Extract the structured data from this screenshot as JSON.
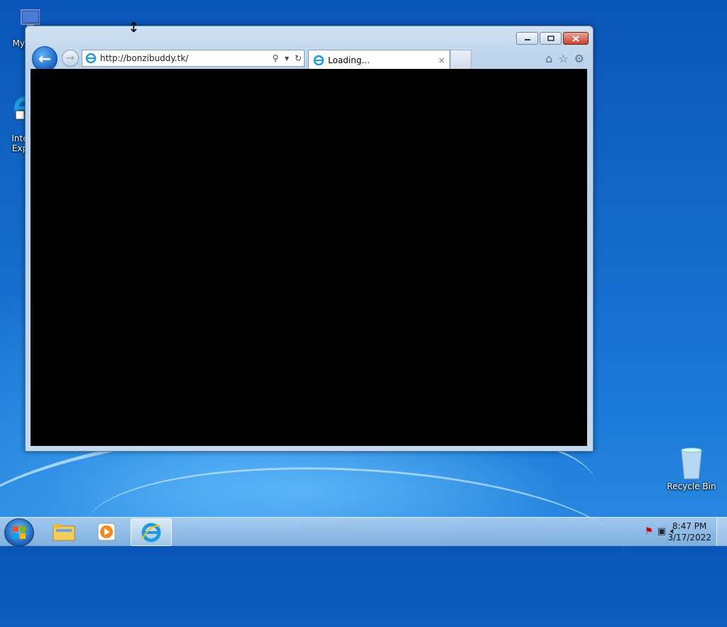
{
  "desktop": {
    "icons": [
      {
        "label": "My Co"
      },
      {
        "label": "Inte\nExp"
      },
      {
        "label": "Recycle Bin"
      }
    ]
  },
  "browser": {
    "address": "http://bonzibuddy.tk/",
    "tab_title": "Loading...",
    "tab_close": "×",
    "back_glyph": "←",
    "forward_glyph": "→"
  },
  "taskbar": {
    "time": "8:47 PM",
    "date": "3/17/2022"
  },
  "icons": {
    "start": "windows-orb-icon",
    "explorer": "folder-icon",
    "media": "media-player-icon",
    "ie": "internet-explorer-icon",
    "home": "home-icon",
    "favorites": "star-icon",
    "tools": "gear-icon"
  }
}
